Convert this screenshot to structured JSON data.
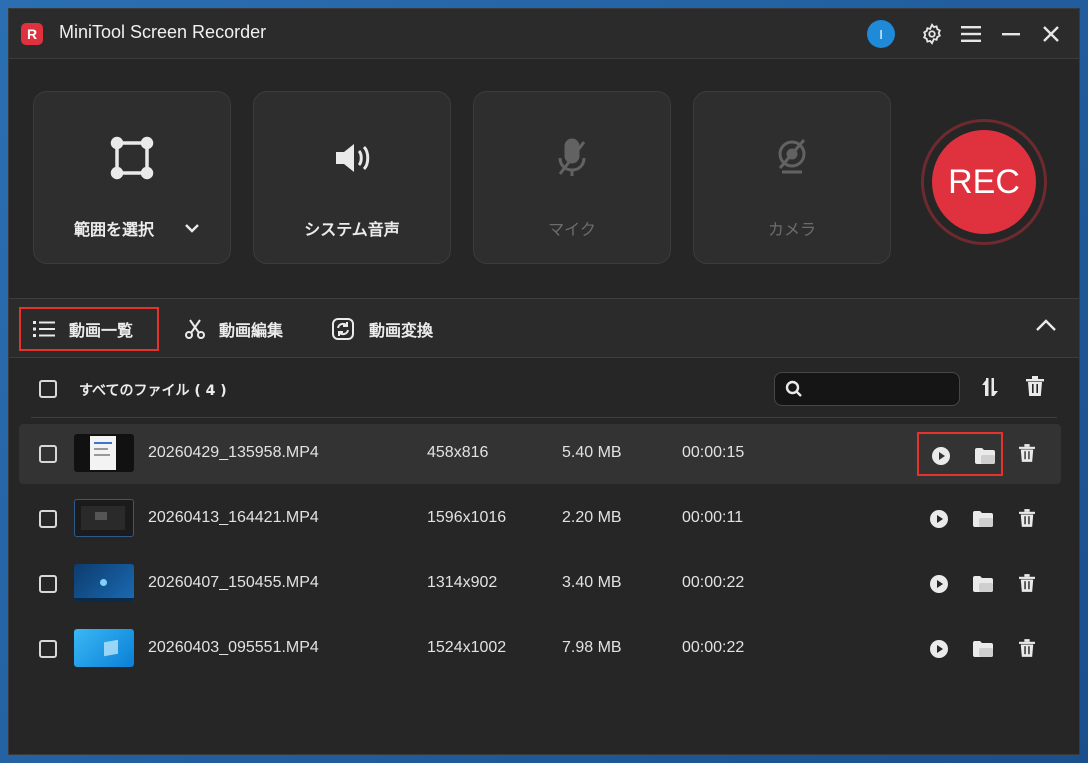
{
  "titlebar": {
    "logo_letter": "R",
    "title": "MiniTool Screen Recorder",
    "avatar_letter": "I",
    "icons": [
      "settings-gear-icon",
      "menu-hamburger-icon",
      "minimize-icon",
      "close-icon"
    ]
  },
  "modes": {
    "area": {
      "label": "範囲を選択",
      "icon": "crop-frame-icon",
      "enabled": true
    },
    "system_audio": {
      "label": "システム音声",
      "icon": "speaker-icon",
      "enabled": true
    },
    "mic": {
      "label": "マイク",
      "icon": "mic-off-icon",
      "enabled": false
    },
    "camera": {
      "label": "カメラ",
      "icon": "camera-off-icon",
      "enabled": false
    },
    "rec_label": "REC"
  },
  "tabs": [
    {
      "label": "動画一覧",
      "icon": "list-icon",
      "active": true
    },
    {
      "label": "動画編集",
      "icon": "scissors-icon",
      "active": false
    },
    {
      "label": "動画変換",
      "icon": "convert-icon",
      "active": false
    }
  ],
  "list": {
    "all_files_label": "すべてのファイル ( 4 )",
    "search_placeholder": "",
    "rows": [
      {
        "name": "20260429_135958.MP4",
        "resolution": "458x816",
        "size": "5.40 MB",
        "duration": "00:00:15",
        "selected": true
      },
      {
        "name": "20260413_164421.MP4",
        "resolution": "1596x1016",
        "size": "2.20 MB",
        "duration": "00:00:11",
        "selected": false
      },
      {
        "name": "20260407_150455.MP4",
        "resolution": "1314x902",
        "size": "3.40 MB",
        "duration": "00:00:22",
        "selected": false
      },
      {
        "name": "20260403_095551.MP4",
        "resolution": "1524x1002",
        "size": "7.98 MB",
        "duration": "00:00:22",
        "selected": false
      }
    ]
  },
  "colors": {
    "accent_red": "#e0313f",
    "highlight_border": "#e5322c",
    "avatar_blue": "#1f8ad8"
  }
}
